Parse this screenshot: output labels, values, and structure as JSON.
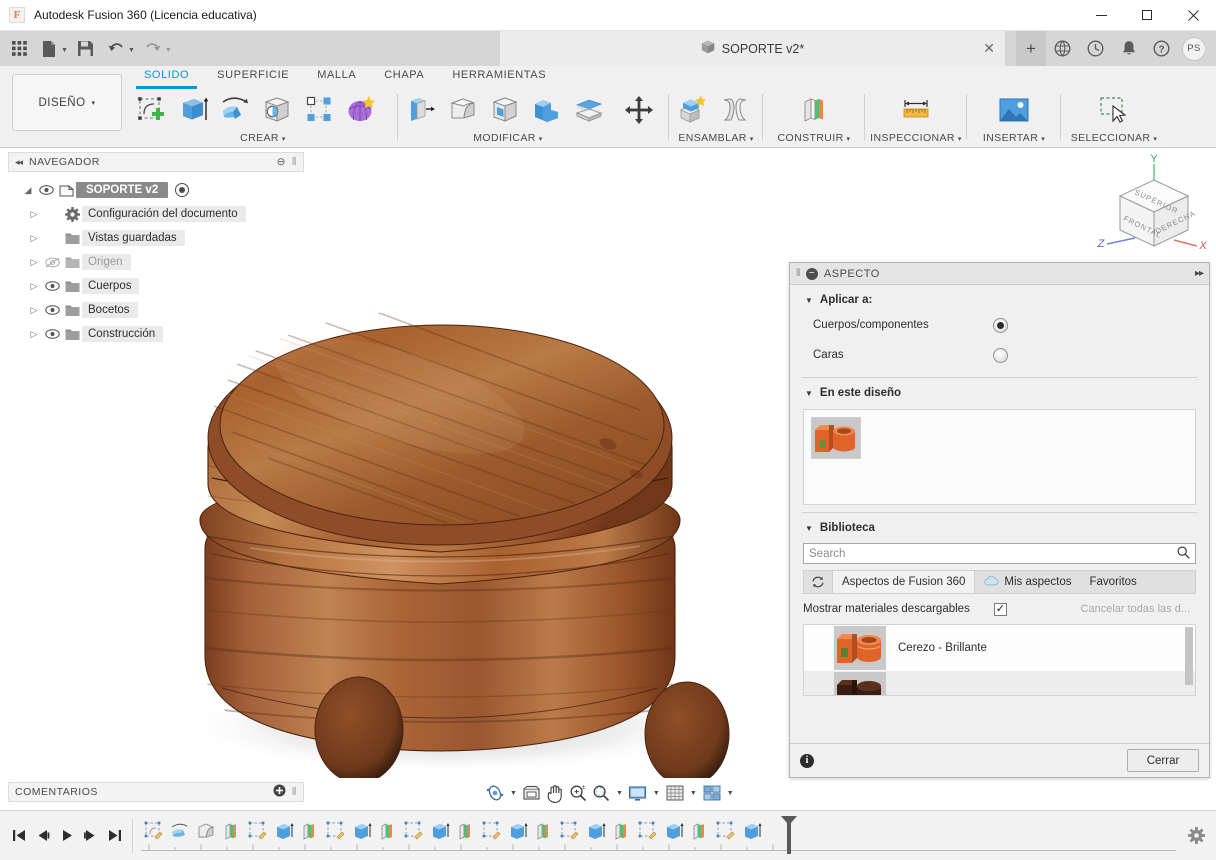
{
  "window": {
    "app_title": "Autodesk Fusion 360 (Licencia educativa)",
    "app_badge": "F",
    "minimize": "—",
    "maximize": "☐",
    "close": "✕"
  },
  "quick_access": {
    "icons": [
      "grid-apps-icon",
      "new-file-icon",
      "save-icon",
      "undo-icon",
      "redo-icon"
    ],
    "doc_tab": {
      "title": "SOPORTE v2*",
      "close": "✕"
    },
    "new_tab": "+",
    "right_icons": [
      "globe-icon",
      "clock-icon",
      "bell-icon",
      "help-icon"
    ],
    "avatar_initials": "PS"
  },
  "ribbon": {
    "workspace": {
      "label": "DISEÑO",
      "caret": "▾"
    },
    "tabs": [
      {
        "label": "SOLIDO",
        "active": true
      },
      {
        "label": "SUPERFICIE",
        "active": false
      },
      {
        "label": "MALLA",
        "active": false
      },
      {
        "label": "CHAPA",
        "active": false
      },
      {
        "label": "HERRAMIENTAS",
        "active": false
      }
    ],
    "panels": [
      {
        "label": "CREAR",
        "caret": "▾"
      },
      {
        "label": "MODIFICAR",
        "caret": "▾"
      },
      {
        "label": "ENSAMBLAR",
        "caret": "▾"
      },
      {
        "label": "CONSTRUIR",
        "caret": "▾"
      },
      {
        "label": "INSPECCIONAR",
        "caret": "▾"
      },
      {
        "label": "INSERTAR",
        "caret": "▾"
      },
      {
        "label": "SELECCIONAR",
        "caret": "▾"
      }
    ]
  },
  "browser": {
    "title": "NAVEGADOR",
    "collapse_icon": "◂◂",
    "minimize_icon": "⊖",
    "root": {
      "label": "SOPORTE v2"
    },
    "items": [
      {
        "label": "Configuración del documento",
        "visible": true,
        "icon": "gear-icon"
      },
      {
        "label": "Vistas guardadas",
        "visible": true,
        "icon": "folder-icon"
      },
      {
        "label": "Origen",
        "visible": false,
        "icon": "folder-icon"
      },
      {
        "label": "Cuerpos",
        "visible": true,
        "icon": "folder-icon"
      },
      {
        "label": "Bocetos",
        "visible": true,
        "icon": "folder-icon"
      },
      {
        "label": "Construcción",
        "visible": true,
        "icon": "folder-icon"
      }
    ]
  },
  "viewcube": {
    "top_face": "SUPERIOR",
    "left_face": "FRONTAL",
    "right_face": "DERECHA",
    "axis_x": "X",
    "axis_y": "Y",
    "axis_z": "Z",
    "axis_x_color": "#e8736c",
    "axis_y_color": "#5fcf7f",
    "axis_z_color": "#6f86e0"
  },
  "appearance_panel": {
    "title": "ASPECTO",
    "minimize_icon": "⊖",
    "expand_icon": "▸▸",
    "apply_to": {
      "title": "Aplicar a:",
      "options": [
        {
          "label": "Cuerpos/componentes",
          "selected": true
        },
        {
          "label": "Caras",
          "selected": false
        }
      ]
    },
    "in_design": {
      "title": "En este diseño",
      "swatches": [
        {
          "name": "Cerezo - Brillante"
        }
      ]
    },
    "library": {
      "title": "Biblioteca",
      "search_placeholder": "Search",
      "search_value": "",
      "refresh_icon": "refresh-icon",
      "tabs": [
        {
          "label": "Aspectos de Fusion 360",
          "active": true,
          "icon": ""
        },
        {
          "label": "Mis aspectos",
          "active": false,
          "icon": "cloud-icon"
        },
        {
          "label": "Favoritos",
          "active": false,
          "icon": ""
        }
      ],
      "show_downloadable_label": "Mostrar materiales descargables",
      "show_downloadable_checked": true,
      "cancel_downloads_label": "Cancelar todas las d...",
      "materials": [
        {
          "name": "Cerezo - Brillante",
          "color_a": "#e0642a",
          "color_b": "#f2884b"
        },
        {
          "name": "",
          "color_a": "#3a1e13",
          "color_b": "#5a2f1c"
        }
      ]
    },
    "footer": {
      "info_icon": "info-icon",
      "close_label": "Cerrar"
    }
  },
  "view_toolbar": {
    "buttons": [
      {
        "name": "orbit-icon",
        "caret": true
      },
      {
        "name": "look-at-icon",
        "caret": false
      },
      {
        "name": "pan-hand-icon",
        "caret": false
      },
      {
        "name": "zoom-icon",
        "caret": false
      },
      {
        "name": "zoom-window-icon",
        "caret": true
      },
      {
        "name": "display-settings-icon",
        "caret": true
      },
      {
        "name": "grid-snap-icon",
        "caret": true
      },
      {
        "name": "viewports-icon",
        "caret": true
      }
    ]
  },
  "comments": {
    "title": "COMENTARIOS",
    "add_icon": "⊕"
  },
  "timeline": {
    "playback": [
      {
        "name": "jump-start-button",
        "glyph": "⏮"
      },
      {
        "name": "step-back-button",
        "glyph": "⏴"
      },
      {
        "name": "play-button",
        "glyph": "⏵"
      },
      {
        "name": "step-forward-button",
        "glyph": "⏵"
      },
      {
        "name": "jump-end-button",
        "glyph": "⏭"
      }
    ],
    "features": [
      "sketch",
      "revolve",
      "fillet",
      "split",
      "sketch",
      "extrude",
      "split",
      "sketch",
      "extrude",
      "split",
      "sketch",
      "extrude",
      "split",
      "sketch",
      "extrude",
      "split",
      "sketch",
      "extrude",
      "split",
      "sketch",
      "extrude",
      "split",
      "sketch",
      "extrude"
    ],
    "settings_icon": "gear-icon"
  },
  "colors": {
    "accent": "#0696d7",
    "titlebar_bg": "#ffffff",
    "qa_bg": "#d6d6d6",
    "ribbon_bg": "#f0f0f0",
    "panel_bg": "#f0f0f0",
    "wood_light": "#c78a5a",
    "wood_mid": "#9a5a33",
    "wood_dark": "#6e3a1f"
  }
}
